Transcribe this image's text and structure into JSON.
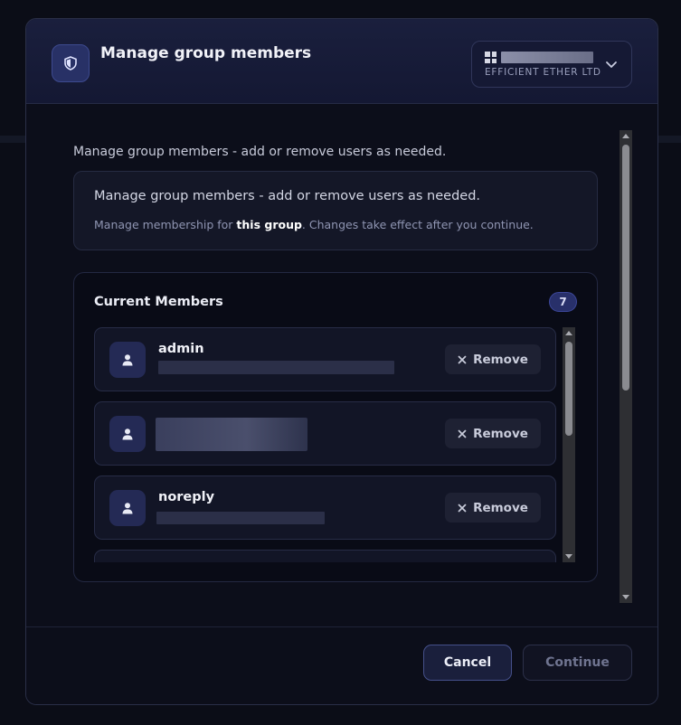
{
  "modal": {
    "title": "Manage group members"
  },
  "org_switcher": {
    "subtitle": "EFFICIENT ETHER LTD"
  },
  "body": {
    "description": "Manage group members - add or remove users as needed.",
    "info": {
      "title": "Manage group members - add or remove users as needed.",
      "sub_prefix": "Manage membership for ",
      "sub_bold": "this group",
      "sub_suffix": ". Changes take effect after you continue."
    }
  },
  "members": {
    "title": "Current Members",
    "count": "7",
    "items": [
      {
        "name": "admin",
        "remove_label": "Remove"
      },
      {
        "name": "",
        "remove_label": "Remove"
      },
      {
        "name": "noreply",
        "remove_label": "Remove"
      }
    ]
  },
  "footer": {
    "cancel_label": "Cancel",
    "continue_label": "Continue"
  },
  "icons": {
    "header": "shield-icon",
    "avatar": "user-icon",
    "remove": "close-icon",
    "org_toggle": "chevron-down-icon"
  },
  "colors": {
    "background": "#0b0d17",
    "header_gradient_top": "#1a1f3d",
    "accent_badge": "#28306a",
    "avatar_bg": "#242a55"
  }
}
